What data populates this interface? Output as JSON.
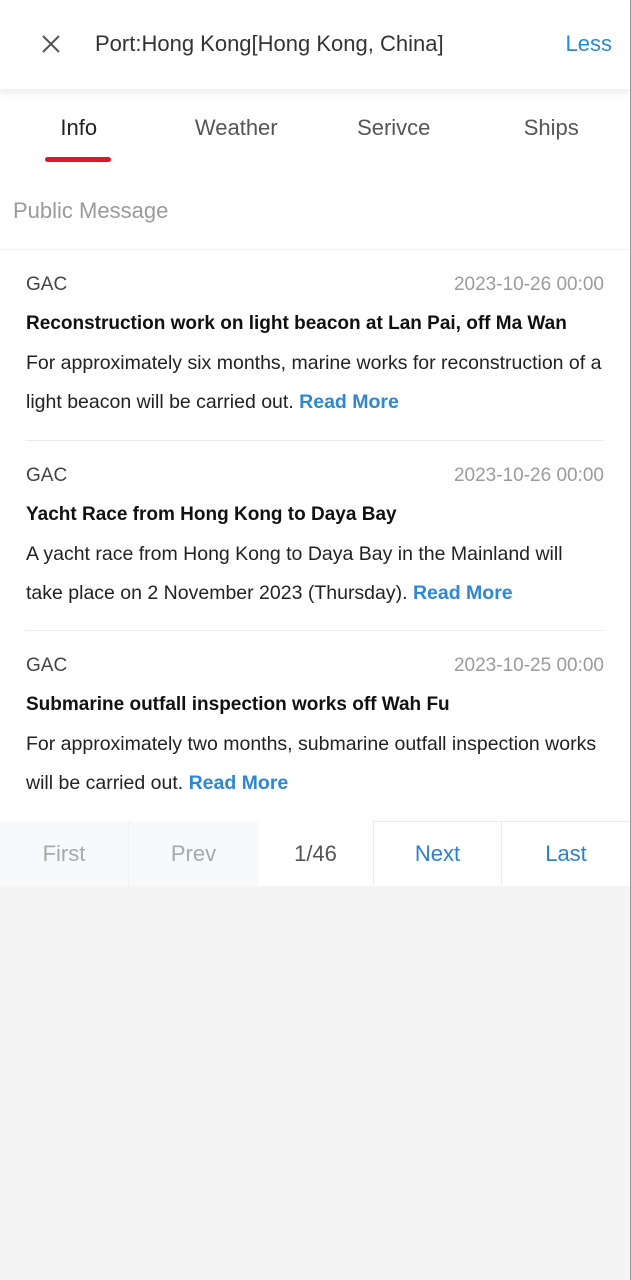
{
  "header": {
    "close_icon": "close-icon",
    "title": "Port:Hong Kong[Hong Kong, China]",
    "less_label": "Less"
  },
  "tabs": [
    {
      "label": "Info",
      "active": true
    },
    {
      "label": "Weather",
      "active": false
    },
    {
      "label": "Serivce",
      "active": false
    },
    {
      "label": "Ships",
      "active": false
    }
  ],
  "colors": {
    "accent_blue": "#2d87d3",
    "active_tab_indicator": "#e0162b",
    "background": "#f4f4f4"
  },
  "section": {
    "label": "Public Message"
  },
  "messages": [
    {
      "source": "GAC",
      "date": "2023-10-26 00:00",
      "title": "Reconstruction work on light beacon at Lan Pai, off Ma Wan",
      "body": "For approximately six months, marine works for reconstruction of a light beacon will be carried out.",
      "read_more": "Read More"
    },
    {
      "source": "GAC",
      "date": "2023-10-26 00:00",
      "title": "Yacht Race from Hong Kong to Daya Bay",
      "body": "A yacht race from Hong Kong to Daya Bay in the Mainland will take place on 2 November 2023 (Thursday).",
      "read_more": "Read More"
    },
    {
      "source": "GAC",
      "date": "2023-10-25 00:00",
      "title": "Submarine outfall inspection works off Wah Fu",
      "body": "For approximately two months, submarine outfall inspection works will be carried out.",
      "read_more": "Read More"
    }
  ],
  "pagination": {
    "first_label": "First",
    "prev_label": "Prev",
    "page_indicator": "1/46",
    "current_page": 1,
    "total_pages": 46,
    "next_label": "Next",
    "last_label": "Last"
  }
}
